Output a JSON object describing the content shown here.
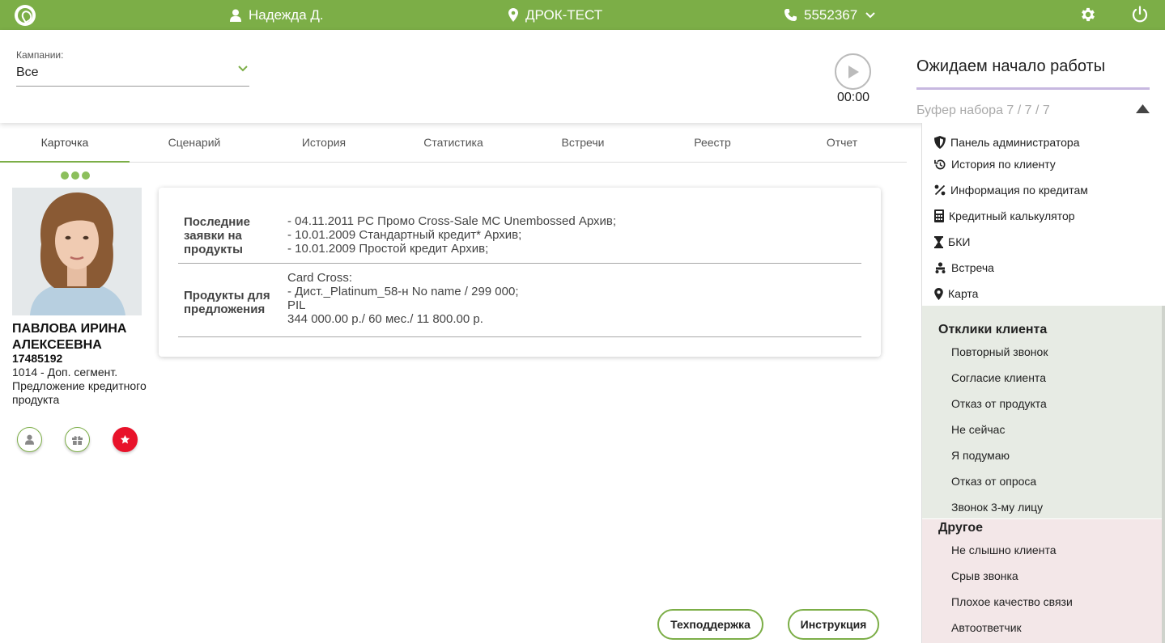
{
  "topbar": {
    "logo_icon": "globe-logo-icon",
    "user_name": "Надежда Д.",
    "location": "ДРОК-ТЕСТ",
    "phone": "5552367",
    "accent_color": "#7cae47"
  },
  "campaign": {
    "label": "Кампании:",
    "value": "Все"
  },
  "call": {
    "timer": "00:00",
    "status": "Ожидаем начало работы",
    "buffer": "Буфер набора 7 / 7 / 7"
  },
  "tabs": [
    {
      "label": "Карточка",
      "active": true
    },
    {
      "label": "Сценарий"
    },
    {
      "label": "История"
    },
    {
      "label": "Статистика"
    },
    {
      "label": "Встречи"
    },
    {
      "label": "Реестр"
    },
    {
      "label": "Отчет"
    }
  ],
  "client": {
    "name": "ПАВЛОВА ИРИНА АЛЕКСЕЕВНА",
    "id": "17485192",
    "segment": "1014 - Доп. сегмент. Предложение кредитного продукта"
  },
  "card": {
    "row1": {
      "label": "Последние заявки на продукты",
      "lines": [
        "- 04.11.2011 PC Промо Cross-Sale MC Unembossed Архив;",
        "- 10.01.2009 Стандартный кредит* Архив;",
        "- 10.01.2009 Простой кредит Архив;"
      ]
    },
    "row2": {
      "label": "Продукты для предложения",
      "lines": [
        "Card Cross:",
        "- Дист._Platinum_58-н No name / 299 000;",
        "PIL",
        "344 000.00 р./ 60 мес./ 11 800.00 р."
      ]
    }
  },
  "buttons": {
    "support": "Техподдержка",
    "manual": "Инструкция"
  },
  "sidebar": {
    "menu": [
      {
        "label": "Панель администратора",
        "icon": "shield-icon"
      },
      {
        "label": "История по клиенту",
        "icon": "history-icon"
      },
      {
        "label": "Информация по кредитам",
        "icon": "percent-icon"
      },
      {
        "label": "Кредитный калькулятор",
        "icon": "calculator-icon"
      },
      {
        "label": "БКИ",
        "icon": "hourglass-icon"
      },
      {
        "label": "Встреча",
        "icon": "meeting-icon"
      },
      {
        "label": "Карта",
        "icon": "map-pin-icon"
      }
    ],
    "responses_title": "Отклики клиента",
    "responses": [
      "Повторный звонок",
      "Согласие клиента",
      "Отказ от продукта",
      "Не сейчас",
      "Я подумаю",
      "Отказ от опроса",
      "Звонок 3-му лицу"
    ],
    "other_title": "Другое",
    "other": [
      "Не слышно клиента",
      "Срыв звонка",
      "Плохое качество связи",
      "Автоответчик"
    ]
  }
}
